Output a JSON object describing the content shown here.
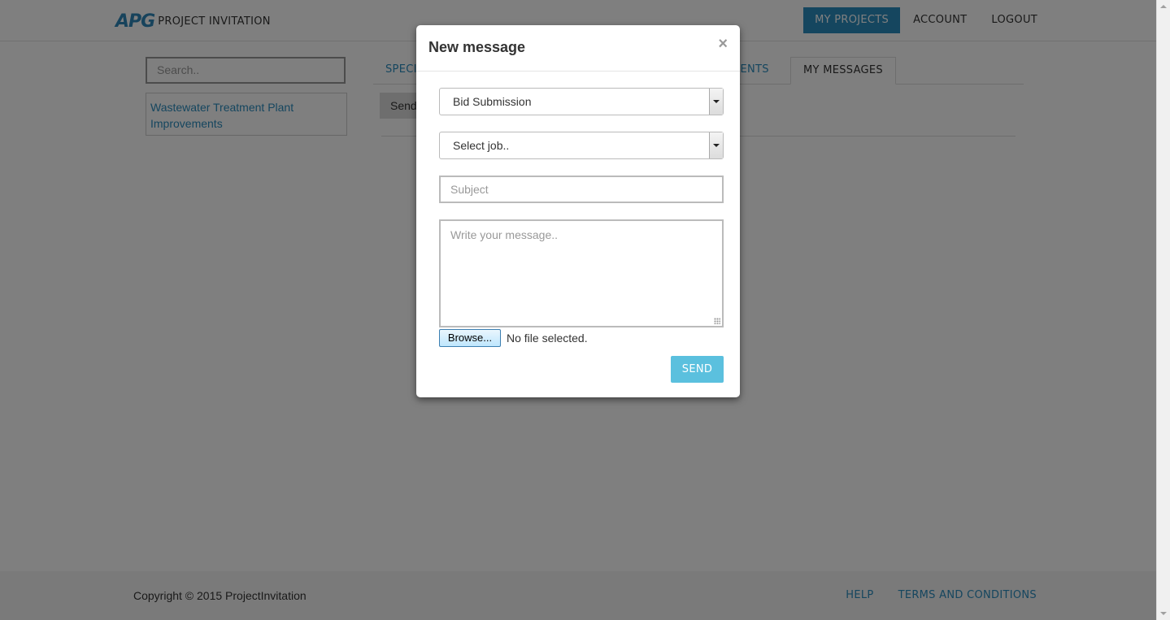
{
  "header": {
    "logo_mark": "APG",
    "app_name": "PROJECT INVITATION",
    "nav": [
      {
        "label": "MY PROJECTS",
        "active": true
      },
      {
        "label": "ACCOUNT",
        "active": false
      },
      {
        "label": "LOGOUT",
        "active": false
      }
    ]
  },
  "sidebar": {
    "search_placeholder": "Search..",
    "projects": [
      "Wastewater Treatment Plant Improvements"
    ]
  },
  "tabs": {
    "first_visible": "SPECI",
    "partial": "MENTS",
    "active": "MY MESSAGES"
  },
  "main": {
    "send_button_partial": "Send"
  },
  "modal": {
    "title": "New message",
    "close_symbol": "×",
    "message_type": "Bid Submission",
    "job_select": "Select job..",
    "subject_placeholder": "Subject",
    "message_placeholder": "Write your message..",
    "browse_label": "Browse...",
    "file_status": "No file selected.",
    "send_label": "SEND"
  },
  "footer": {
    "copyright": "Copyright © 2015 ProjectInvitation",
    "links": [
      "HELP",
      "TERMS AND CONDITIONS"
    ]
  },
  "colors": {
    "brand": "#2b8cbe",
    "send_button": "#5bc0de"
  }
}
